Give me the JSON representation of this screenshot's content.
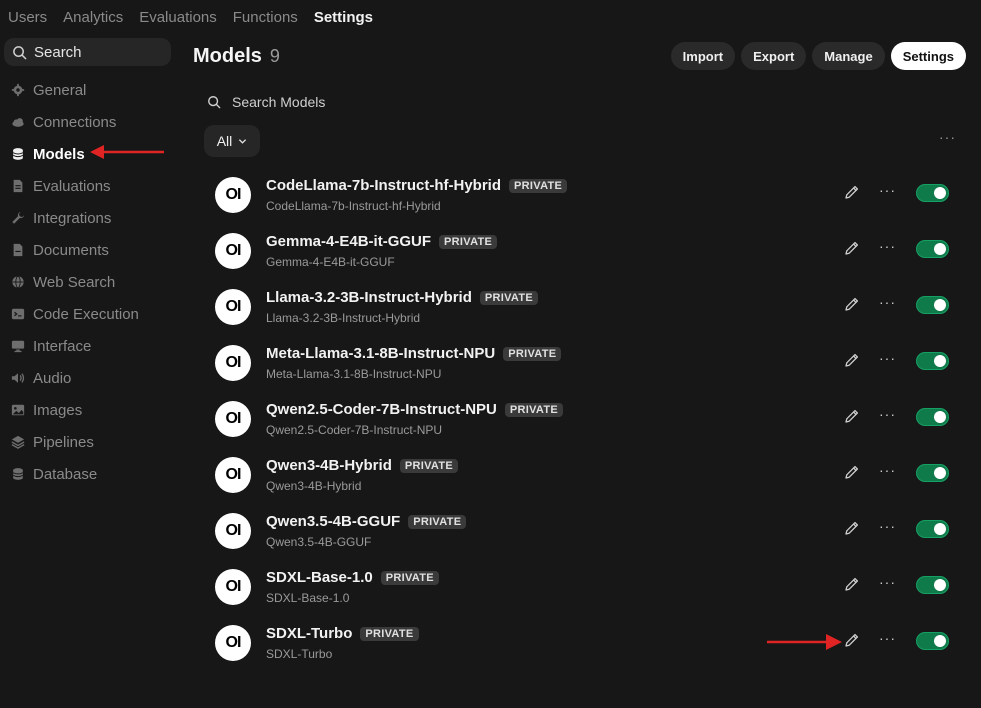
{
  "topnav": {
    "items": [
      "Users",
      "Analytics",
      "Evaluations",
      "Functions",
      "Settings"
    ],
    "active": "Settings"
  },
  "sidebar": {
    "search_label": "Search",
    "items": [
      {
        "label": "General",
        "icon": "gear-icon"
      },
      {
        "label": "Connections",
        "icon": "cloud-icon"
      },
      {
        "label": "Models",
        "icon": "database-icon"
      },
      {
        "label": "Evaluations",
        "icon": "document-icon"
      },
      {
        "label": "Integrations",
        "icon": "wrench-icon"
      },
      {
        "label": "Documents",
        "icon": "file-icon"
      },
      {
        "label": "Web Search",
        "icon": "globe-icon"
      },
      {
        "label": "Code Execution",
        "icon": "terminal-icon"
      },
      {
        "label": "Interface",
        "icon": "monitor-icon"
      },
      {
        "label": "Audio",
        "icon": "speaker-icon"
      },
      {
        "label": "Images",
        "icon": "image-icon"
      },
      {
        "label": "Pipelines",
        "icon": "layers-icon"
      },
      {
        "label": "Database",
        "icon": "database-icon"
      }
    ],
    "active": "Models"
  },
  "main": {
    "title": "Models",
    "count": "9",
    "buttons": {
      "import": "Import",
      "export": "Export",
      "manage": "Manage",
      "settings": "Settings"
    },
    "search_placeholder": "Search Models",
    "filter_label": "All",
    "models": [
      {
        "name": "CodeLlama-7b-Instruct-hf-Hybrid",
        "id": "CodeLlama-7b-Instruct-hf-Hybrid",
        "badge": "PRIVATE",
        "enabled": true
      },
      {
        "name": "Gemma-4-E4B-it-GGUF",
        "id": "Gemma-4-E4B-it-GGUF",
        "badge": "PRIVATE",
        "enabled": true
      },
      {
        "name": "Llama-3.2-3B-Instruct-Hybrid",
        "id": "Llama-3.2-3B-Instruct-Hybrid",
        "badge": "PRIVATE",
        "enabled": true
      },
      {
        "name": "Meta-Llama-3.1-8B-Instruct-NPU",
        "id": "Meta-Llama-3.1-8B-Instruct-NPU",
        "badge": "PRIVATE",
        "enabled": true
      },
      {
        "name": "Qwen2.5-Coder-7B-Instruct-NPU",
        "id": "Qwen2.5-Coder-7B-Instruct-NPU",
        "badge": "PRIVATE",
        "enabled": true
      },
      {
        "name": "Qwen3-4B-Hybrid",
        "id": "Qwen3-4B-Hybrid",
        "badge": "PRIVATE",
        "enabled": true
      },
      {
        "name": "Qwen3.5-4B-GGUF",
        "id": "Qwen3.5-4B-GGUF",
        "badge": "PRIVATE",
        "enabled": true
      },
      {
        "name": "SDXL-Base-1.0",
        "id": "SDXL-Base-1.0",
        "badge": "PRIVATE",
        "enabled": true
      },
      {
        "name": "SDXL-Turbo",
        "id": "SDXL-Turbo",
        "badge": "PRIVATE",
        "enabled": true
      }
    ],
    "logo_text": "OI"
  },
  "colors": {
    "accent_toggle": "#0f7a4a",
    "annotation_arrow": "#e02424"
  }
}
